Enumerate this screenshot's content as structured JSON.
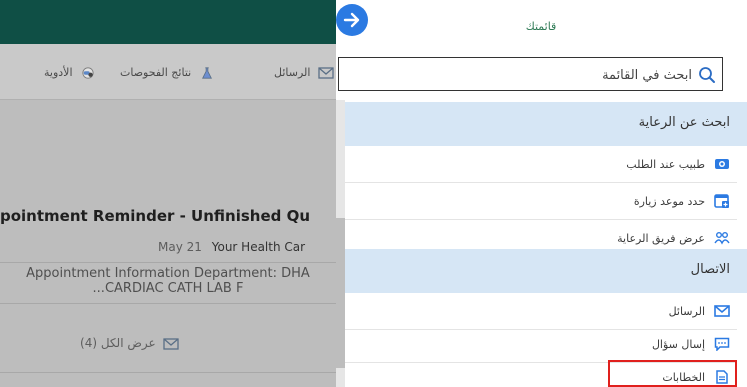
{
  "background": {
    "nav": {
      "messages": "الرسائل",
      "lab_results": "نتائج الفحوصات",
      "medications": "الأدوية"
    },
    "reminder": {
      "title": "pointment Reminder - Unfinished Qu",
      "date": "May 21",
      "from": "Your Health Car",
      "body_line1": "Appointment Information Department: DHA",
      "body_line2": "...CARDIAC CATH LAB F"
    },
    "view_all": "عرض الكل (4)"
  },
  "panel": {
    "title": "قائمتك",
    "search": {
      "value": "ابحث في القائمة"
    },
    "sections": [
      {
        "title": "ابحث عن الرعاية",
        "items": [
          {
            "label": "طبيب عند الطلب",
            "icon": "video-camera-icon"
          },
          {
            "label": "حدد موعد زيارة",
            "icon": "calendar-add-icon"
          },
          {
            "label": "عرض فريق الرعاية",
            "icon": "care-team-icon"
          }
        ]
      },
      {
        "title": "الاتصال",
        "items": [
          {
            "label": "الرسائل",
            "icon": "envelope-icon"
          },
          {
            "label": "إسال سؤال",
            "icon": "chat-bubble-icon"
          },
          {
            "label": "الخطابات",
            "icon": "letter-document-icon"
          }
        ]
      }
    ]
  },
  "colors": {
    "header": "#0f4f45",
    "section_bg": "#d6e6f5",
    "icon_blue": "#2b7ae2",
    "highlight": "#e0201d"
  }
}
